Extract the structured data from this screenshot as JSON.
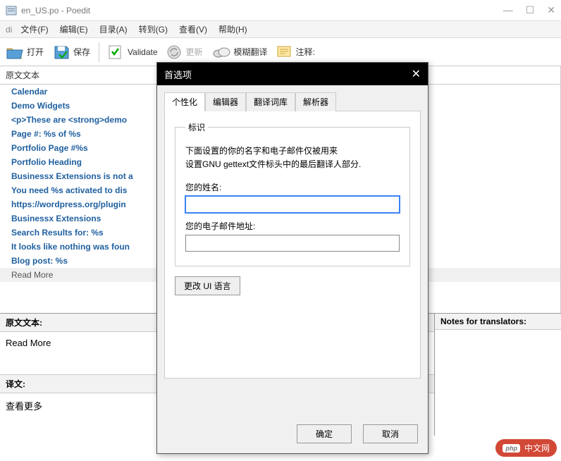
{
  "window": {
    "title": "en_US.po - Poedit"
  },
  "menu": {
    "file": "文件(F)",
    "edit": "编辑(E)",
    "catalog": "目录(A)",
    "goto": "转到(G)",
    "view": "查看(V)",
    "help": "帮助(H)"
  },
  "toolbar": {
    "open": "打开",
    "save": "保存",
    "validate": "Validate",
    "update": "更新",
    "fuzzy": "模糊翻译",
    "notes": "注释:"
  },
  "list": {
    "header": "原文文本",
    "rows": [
      "Calendar",
      "Demo Widgets",
      "<p>These are <strong>demo",
      "Page #: %s of %s",
      "Portfolio Page #%s",
      "Portfolio Heading",
      "Businessx Extensions is not a",
      "You need %s activated to dis",
      "https://wordpress.org/plugin",
      "Businessx Extensions",
      "Search Results for: %s",
      "It looks like nothing was foun",
      "Blog post: %s"
    ],
    "plain_row": "Read More"
  },
  "panels": {
    "source_label": "原文文本:",
    "source_text": "Read More",
    "trans_label": "译文:",
    "trans_text": "查看更多",
    "notes_label": "Notes for translators:"
  },
  "dialog": {
    "title": "首选项",
    "tabs": {
      "personal": "个性化",
      "editor": "编辑器",
      "tm": "翻译词库",
      "parser": "解析器"
    },
    "fieldset_legend": "标识",
    "info_line1": "下面设置的你的名字和电子邮件仅被用来",
    "info_line2": "设置GNU gettext文件标头中的最后翻译人部分.",
    "name_label": "您的姓名:",
    "name_value": "",
    "email_label": "您的电子邮件地址:",
    "email_value": "",
    "lang_btn": "更改 UI 语言",
    "ok": "确定",
    "cancel": "取消"
  },
  "watermark": {
    "tag": "php",
    "text": "中文网"
  }
}
